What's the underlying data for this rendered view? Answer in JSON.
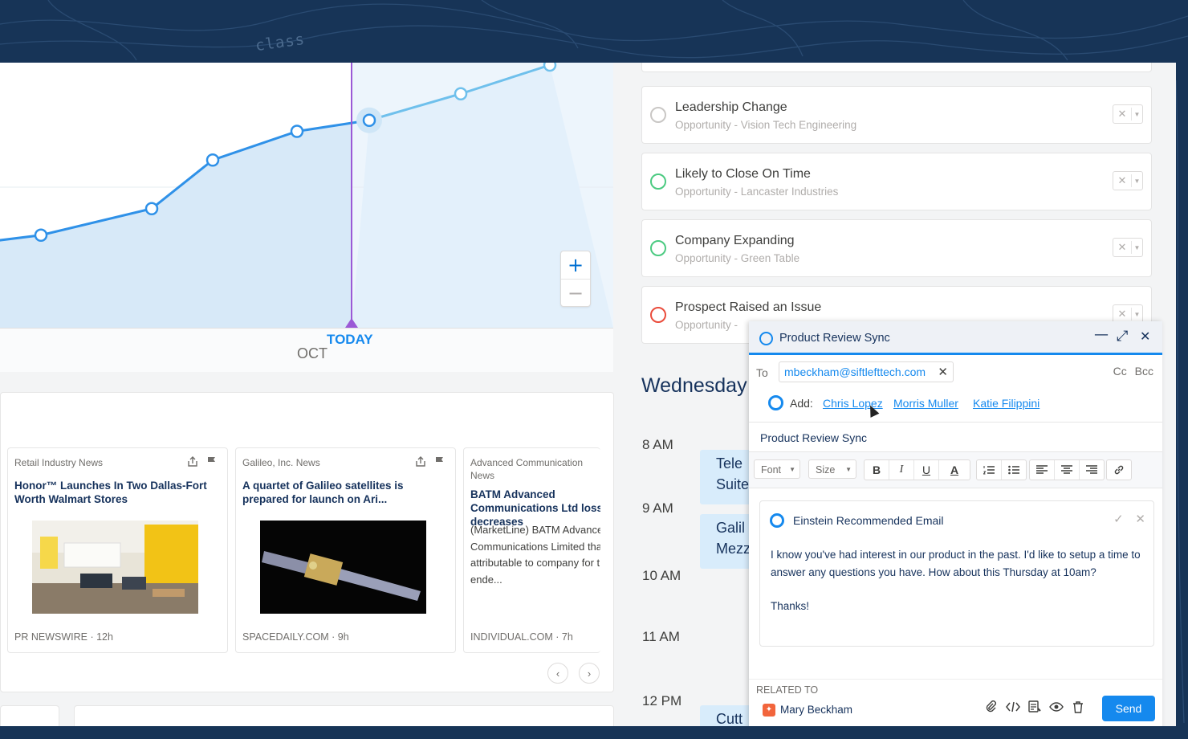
{
  "chart": {
    "tick_month": "OCT",
    "tick_today": "TODAY",
    "zoom_in": "+",
    "zoom_out": "−",
    "colors": {
      "line": "#2f91e8",
      "today_marker": "#9b59d6",
      "area": "#d7e9f8"
    }
  },
  "chart_data": {
    "type": "area",
    "x": [
      "",
      "",
      "",
      "",
      "",
      "",
      "",
      "",
      ""
    ],
    "series": [
      {
        "values": [
          26,
          31,
          43,
          65,
          78,
          83,
          95,
          108
        ]
      }
    ],
    "today_index": 5,
    "x_ticks": [
      "OCT",
      "TODAY"
    ],
    "grid": true
  },
  "news": {
    "items": [
      {
        "source": "Retail Industry News",
        "title": "Honor™ Launches In Two Dallas-Fort Worth Walmart Stores",
        "footer": "PR NEWSWIRE · 12h",
        "image": "store-interior"
      },
      {
        "source": "Galileo, Inc. News",
        "title": "A quartet of Galileo satellites is prepared for launch on Ari...",
        "footer": "SPACEDAILY.COM · 9h",
        "image": "satellite"
      },
      {
        "source": "Advanced Communication News",
        "title": "BATM Advanced Communications Ltd loss decreases",
        "body": "(MarketLine) BATM Advanced Communications Limited that loss attributable to company for the first six ende...",
        "footer": "INDIVIDUAL.COM · 7h"
      }
    ],
    "prev": "‹",
    "next": "›"
  },
  "insights": [
    {
      "title": "Leadership Change",
      "subtitle": "Opportunity - Vision Tech Engineering",
      "color": "#c9c7c5"
    },
    {
      "title": "Likely to Close On Time",
      "subtitle": "Opportunity - Lancaster Industries",
      "color": "#4bca81"
    },
    {
      "title": "Company Expanding",
      "subtitle": "Opportunity - Green Table",
      "color": "#4bca81"
    },
    {
      "title": "Prospect Raised an Issue",
      "subtitle": "Opportunity -",
      "color": "#ea4c3c"
    }
  ],
  "calendar": {
    "day": "Wednesday",
    "times": [
      "8 AM",
      "9 AM",
      "10 AM",
      "11 AM",
      "12 PM"
    ],
    "events": [
      {
        "line1": "Tele",
        "line2": "Suite"
      },
      {
        "line1": "Galil",
        "line2": "Mezz"
      },
      {
        "line1": "Cutt",
        "line2": ""
      }
    ]
  },
  "composer": {
    "title": "Product Review Sync",
    "minimize": "—",
    "expand": "⤢",
    "close": "✕",
    "to_label": "To",
    "to_email": "mbeckham@siftlefttech.com",
    "cc_bcc": "Cc Bcc",
    "add_label": "Add:",
    "add_names": [
      "Chris Lopez",
      "Morris Muller",
      "Katie Filippini"
    ],
    "subject": "Product Review Sync",
    "font_label": "Font",
    "size_label": "Size",
    "einstein_title": "Einstein Recommended Email",
    "einstein_body_1": "I know you've had interest in our product in the past. I'd like to setup a time to answer any questions you have. How about this Thursday at 10am?",
    "einstein_body_2": "Thanks!",
    "related_label": "RELATED TO",
    "related_name": "Mary Beckham",
    "send_label": "Send"
  }
}
